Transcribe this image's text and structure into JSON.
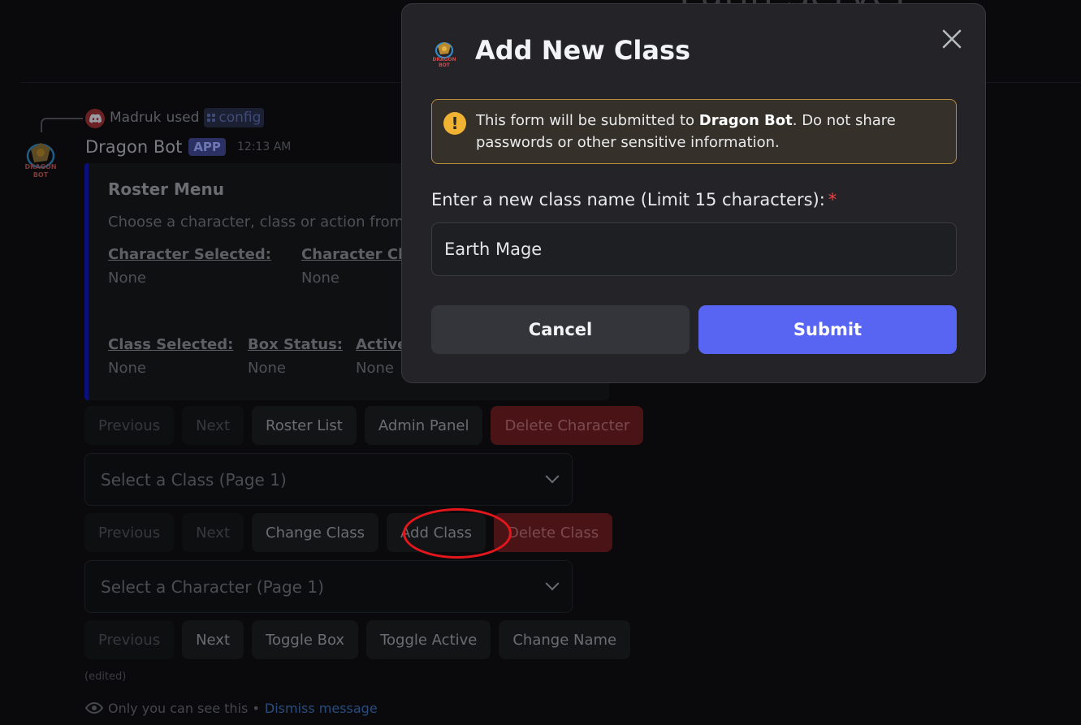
{
  "background": {
    "heading_fragment": "Lutin Server",
    "interaction": {
      "user": "Madruk",
      "used_text": "used",
      "command": "config"
    },
    "bot": {
      "name": "Dragon Bot",
      "badge": "APP",
      "time": "12:13 AM"
    },
    "embed": {
      "title": "Roster Menu",
      "description": "Choose a character, class or action from t",
      "fields_row1": [
        {
          "name": "Character Selected:",
          "value": "None"
        },
        {
          "name": "Character Cla",
          "value": "None"
        }
      ],
      "fields_row2": [
        {
          "name": "Class Selected:",
          "value": "None"
        },
        {
          "name": "Box Status:",
          "value": "None"
        },
        {
          "name": "Active",
          "value": "None"
        }
      ]
    },
    "row1_buttons": [
      "Previous",
      "Next",
      "Roster List",
      "Admin Panel",
      "Delete Character"
    ],
    "class_select": "Select a Class (Page 1)",
    "row2_buttons": [
      "Previous",
      "Next",
      "Change Class",
      "Add Class",
      "Delete Class"
    ],
    "character_select": "Select a Character (Page 1)",
    "row3_buttons": [
      "Previous",
      "Next",
      "Toggle Box",
      "Toggle Active",
      "Change Name"
    ],
    "edited": "(edited)",
    "ephemeral": {
      "text": "Only you can see this •",
      "dismiss": "Dismiss message"
    }
  },
  "modal": {
    "title": "Add New Class",
    "warning": {
      "prefix": "This form will be submitted to ",
      "bot": "Dragon Bot",
      "suffix": ". Do not share passwords or other sensitive information."
    },
    "input_label": "Enter a new class name (Limit 15 characters):",
    "required_mark": "*",
    "input_value": "Earth Mage",
    "cancel": "Cancel",
    "submit": "Submit"
  },
  "colors": {
    "accent": "#5865f2",
    "danger": "#da373c",
    "warning": "#f0b232",
    "annotation_circle": "#e3161c"
  }
}
